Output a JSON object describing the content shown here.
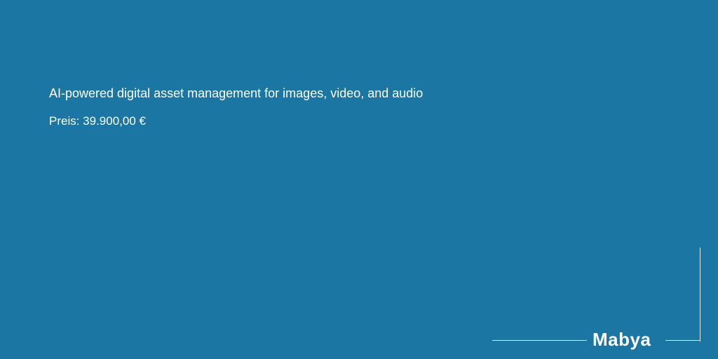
{
  "content": {
    "headline": "AI-powered digital asset management for images, video, and audio",
    "price": "Preis: 39.900,00 €"
  },
  "brand": {
    "name": "Mabya"
  },
  "colors": {
    "background": "#1b76a3",
    "text": "#ffffff",
    "frame_line": "#ffffff"
  }
}
